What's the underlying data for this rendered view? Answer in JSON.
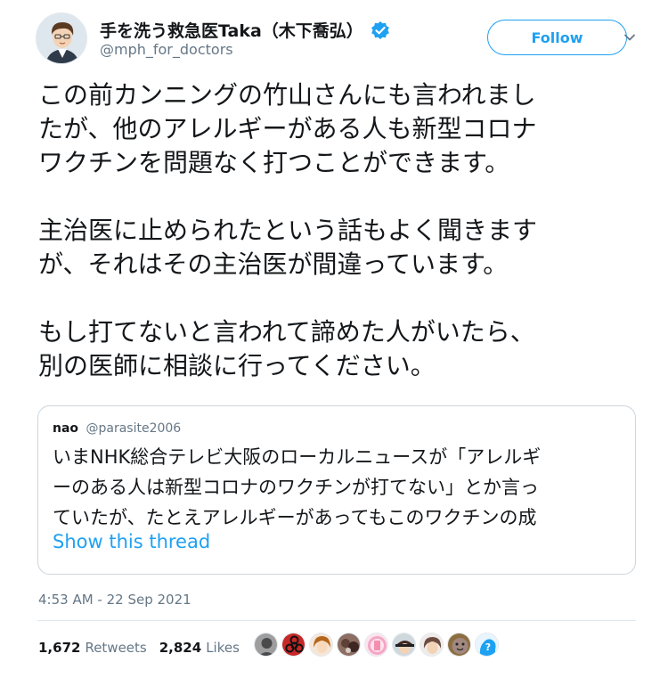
{
  "author": {
    "display_name": "手を洗う救急医Taka（木下喬弘）",
    "handle": "@mph_for_doctors",
    "verified": true
  },
  "follow_label": "Follow",
  "tweet": {
    "paragraphs": [
      "この前カンニングの竹山さんにも言われまし\nたが、他のアレルギーがある人も新型コロナ\nワクチンを問題なく打つことができます。",
      "主治医に止められたという話もよく聞きます\nが、それはその主治医が間違っています。",
      "もし打てないと言われて諦めた人がいたら、\n別の医師に相談に行ってください。"
    ]
  },
  "quoted_tweet": {
    "name": "nao",
    "handle": "@parasite2006",
    "text": "いまNHK総合テレビ大阪のローカルニュースが「アレルギ\nーのある人は新型コロナのワクチンが打てない」とか言っ\nていたが、たとえアレルギーがあってもこのワクチンの成",
    "show_thread": "Show this thread"
  },
  "timestamp": "4:53 AM - 22 Sep 2021",
  "stats": {
    "retweets_count": "1,672",
    "retweets_label": "Retweets",
    "likes_count": "2,824",
    "likes_label": "Likes"
  },
  "likers": [
    {
      "icon": "liker-avatar",
      "color": "#4a4a4a"
    },
    {
      "icon": "biohazard-icon",
      "color": "#c62828"
    },
    {
      "icon": "liker-avatar",
      "color": "#b5651d"
    },
    {
      "icon": "liker-avatar",
      "color": "#5d4037"
    },
    {
      "icon": "liker-avatar",
      "color": "#f4a6c6"
    },
    {
      "icon": "liker-avatar",
      "color": "#3e2723"
    },
    {
      "icon": "liker-avatar",
      "color": "#6d4c41"
    },
    {
      "icon": "liker-avatar",
      "color": "#8d6e3f"
    },
    {
      "icon": "help-icon",
      "color": "#1da1f2"
    }
  ],
  "colors": {
    "accent": "#1da1f2",
    "text": "#14171a",
    "secondary": "#657786",
    "border": "#ccd6dd"
  }
}
